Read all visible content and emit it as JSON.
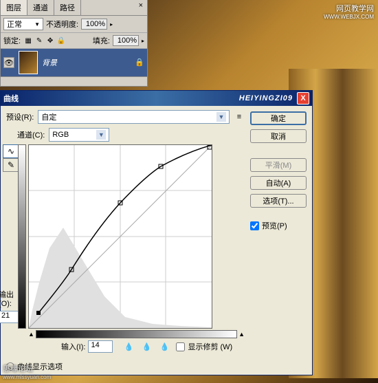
{
  "watermarks": {
    "topRight1": "网页教学网",
    "topRight2": "WWW.WEBJX.COM",
    "bottomLeft1": "思缘论坛",
    "bottomLeft2": "www.missyuan.com"
  },
  "layersPanel": {
    "tabs": {
      "layers": "图层",
      "channels": "通道",
      "paths": "路径",
      "close": "×"
    },
    "blendMode": "正常",
    "opacityLabel": "不透明度:",
    "opacityValue": "100%",
    "lockLabel": "锁定:",
    "fillLabel": "填充:",
    "fillValue": "100%",
    "layerName": "背景"
  },
  "curvesDialog": {
    "title": "曲线",
    "watermarkTitle": "HEIYINGZI09",
    "closeX": "X",
    "presetLabel": "预设(R):",
    "presetValue": "自定",
    "menuIcon": "≡",
    "channelLabel": "通道(C):",
    "channelValue": "RGB",
    "outputLabel": "输出(O):",
    "outputValue": "21",
    "inputLabel": "输入(I):",
    "inputValue": "14",
    "showClippingLabel": "显示修剪 (W)",
    "expandLabel": "曲线显示选项",
    "buttons": {
      "ok": "确定",
      "cancel": "取消",
      "smooth": "平滑(M)",
      "auto": "自动(A)",
      "options": "选项(T)...",
      "preview": "预览(P)"
    }
  },
  "chart_data": {
    "type": "line",
    "title": "曲线",
    "xlabel": "输入",
    "ylabel": "输出",
    "xlim": [
      0,
      255
    ],
    "ylim": [
      0,
      255
    ],
    "series": [
      {
        "name": "curve",
        "points": [
          [
            14,
            21
          ],
          [
            60,
            81
          ],
          [
            128,
            175
          ],
          [
            184,
            225
          ],
          [
            255,
            255
          ]
        ]
      },
      {
        "name": "baseline",
        "points": [
          [
            0,
            0
          ],
          [
            255,
            255
          ]
        ]
      }
    ],
    "selected_point": {
      "input": 14,
      "output": 21
    },
    "histogram": "background-left-skewed"
  }
}
